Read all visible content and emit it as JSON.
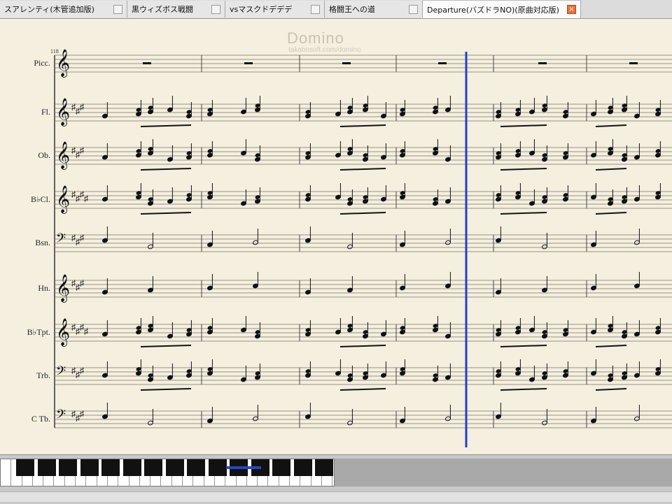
{
  "tabs": [
    {
      "label": "スアレンティ(木管追加版)",
      "active": false,
      "width": 182
    },
    {
      "label": "黒ウィズボス戦闘",
      "active": false,
      "width": 140
    },
    {
      "label": "vsマスクドデデデ",
      "active": false,
      "width": 142
    },
    {
      "label": "格闘王への道",
      "active": false,
      "width": 140
    },
    {
      "label": "Departure(バズドラNO)(原曲対応版)",
      "active": true,
      "width": 226
    }
  ],
  "watermark": {
    "line1": "Domino",
    "line2": "takabosoft.com/domino"
  },
  "measure_number": "118",
  "instruments": [
    "Picc.",
    "Fl.",
    "Ob.",
    "B♭Cl.",
    "Bsn.",
    "Hn.",
    "B♭Tpt.",
    "Trb.",
    "C Tb."
  ],
  "colors": {
    "background": "#f4efdf",
    "staff": "#7a7468",
    "playhead": "#2340c8",
    "note": "#111111"
  }
}
